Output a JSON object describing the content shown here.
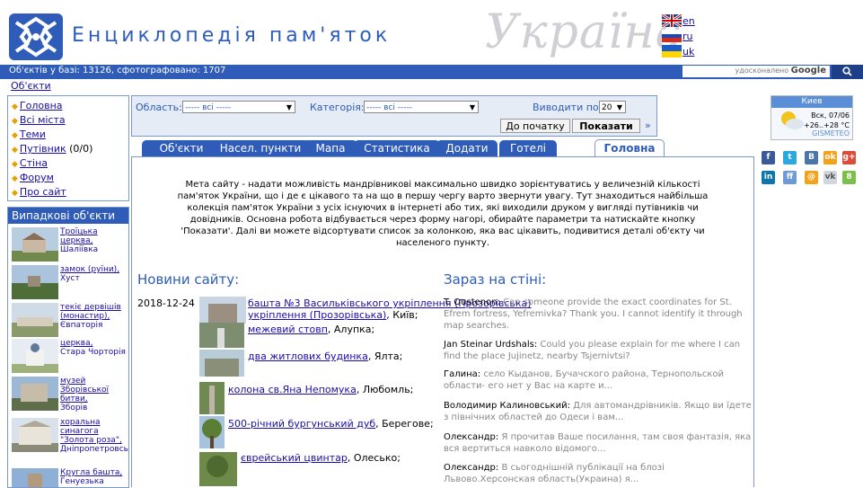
{
  "header": {
    "site_title": "Енциклопедія пам'яток",
    "country_word": "Україна",
    "languages": [
      {
        "code": "en",
        "flag": "uk-flag"
      },
      {
        "code": "ru",
        "flag": "ru-flag"
      },
      {
        "code": "uk",
        "flag": "ua-flag"
      }
    ]
  },
  "statbar": {
    "text": "Об'єктів у базі: 13126, сфотографовано: 1707",
    "google_prefix": "удосконалено",
    "google_brand": "Google",
    "search_icon": "search-icon"
  },
  "breadcrumb": "Об'єкти",
  "nav": {
    "items": [
      {
        "label": "Головна"
      },
      {
        "label": "Всі міста"
      },
      {
        "label": "Теми"
      },
      {
        "label": "Путівник",
        "count": "(0/0)"
      },
      {
        "label": "Стіна"
      },
      {
        "label": "Форум"
      },
      {
        "label": "Про сайт"
      }
    ]
  },
  "random": {
    "title": "Випадкові об'єкти",
    "items": [
      {
        "title": "Троїцька церква,",
        "place": "Шаліївка"
      },
      {
        "title": "замок (руїни),",
        "place": "Хуст"
      },
      {
        "title": "текіє дервішів (монастир),",
        "place": "Євпаторія"
      },
      {
        "title": "церква,",
        "place": "Стара Чорторія"
      },
      {
        "title": "музей Зборівської битви,",
        "place": "Зборів"
      },
      {
        "title": "хоральна синагога \"Золота роза\",",
        "place": "Дніпропетровськ"
      },
      {
        "title": "Кругла башта,",
        "place": "Генуезька"
      }
    ]
  },
  "filter": {
    "region_label": "Область:",
    "region_value": "----- всі -----",
    "category_label": "Категорія:",
    "category_value": "----- всі -----",
    "per_page_label": "Виводити по:",
    "per_page_value": "20",
    "to_start_label": "До початку",
    "show_label": "Показати",
    "more": "»"
  },
  "tabs": [
    {
      "label": "Об'єкти"
    },
    {
      "label": "Насел. пункти"
    },
    {
      "label": "Мапа"
    },
    {
      "label": "Статистика"
    },
    {
      "label": "Додати"
    },
    {
      "label": "Готелі"
    },
    {
      "label": "Головна",
      "active": true
    }
  ],
  "intro": "Мета сайту - надати можливість мандрівникові максимально швидко зорієнтуватись у величезній кількості пам'яток України, що і де є цікавого та на що в першу чергу варто звернути увагу. Тут знаходиться найбільша колекція пам'яток України з усіх існуючих в інтернеті або тих, які виходили друком у вигляді путівників чи довідників. Основна робота відбувається через форму нагорі, обирайте параметри та натискайте кнопку 'Показати'. Далі ви можете відсортувати список за колонкою, яка вас цікавить, подивитися деталі об'єкту чи населеного пункту.",
  "news": {
    "title": "Новини сайту:",
    "date": "2018-12-24",
    "items": [
      {
        "link": "башта №3 Васильківського укріплення (Прозорівська)",
        "place": ", Київ;"
      },
      {
        "link": "межевий стовп",
        "place": ", Алупка;"
      },
      {
        "link": "два житлових будинка",
        "place": ", Ялта;"
      },
      {
        "link": "колона св.Яна Непомука",
        "place": ", Любомль;"
      },
      {
        "link": "500-річний бургунський дуб",
        "place": ", Берегове;"
      },
      {
        "link": "єврейський цвинтар",
        "place": ", Олесько;"
      }
    ]
  },
  "wall": {
    "title": "Зараз на стіні:",
    "posts": [
      {
        "author": "T. Oustenon:",
        "text": "Can someone provide the exact coordinates for St. Efrem fortress, Yefremivka? Thank you. I cannot identify it through map searches."
      },
      {
        "author": "Jan Steinar Urdshals:",
        "text": "Could you please explain for me where I can find the place Jujinetz, nearby Tsjernivtsi?"
      },
      {
        "author": "Галина:",
        "text": "село Кыданов, Бучачского района, Тернопольской области- его нет у Вас на карте и..."
      },
      {
        "author": "Володимир Калиновський:",
        "text": "Для автомандрівників. Якщо ви їдете з північних областей до Одеси і вам..."
      },
      {
        "author": "Олександр:",
        "text": "Я прочитав Ваше посилання, там своя фантазія, яка вся вертиться навколо відомого..."
      },
      {
        "author": "Олександр:",
        "text": "В сьогоднішній публікації на блозі Львово.Херсонская область(Украина) я..."
      }
    ]
  },
  "weather": {
    "city": "Киев",
    "date": "Вск, 07/06",
    "temp": "+26..+28 °С",
    "brand": "GISMETEO"
  },
  "social": [
    "f",
    "t",
    "B",
    "ok",
    "g+",
    "in",
    "ff",
    "@",
    "vk",
    "8"
  ],
  "colors": {
    "brand_blue": "#2e5cb8",
    "link": "#1a0dab",
    "nav_bullet": "#e8a000"
  }
}
